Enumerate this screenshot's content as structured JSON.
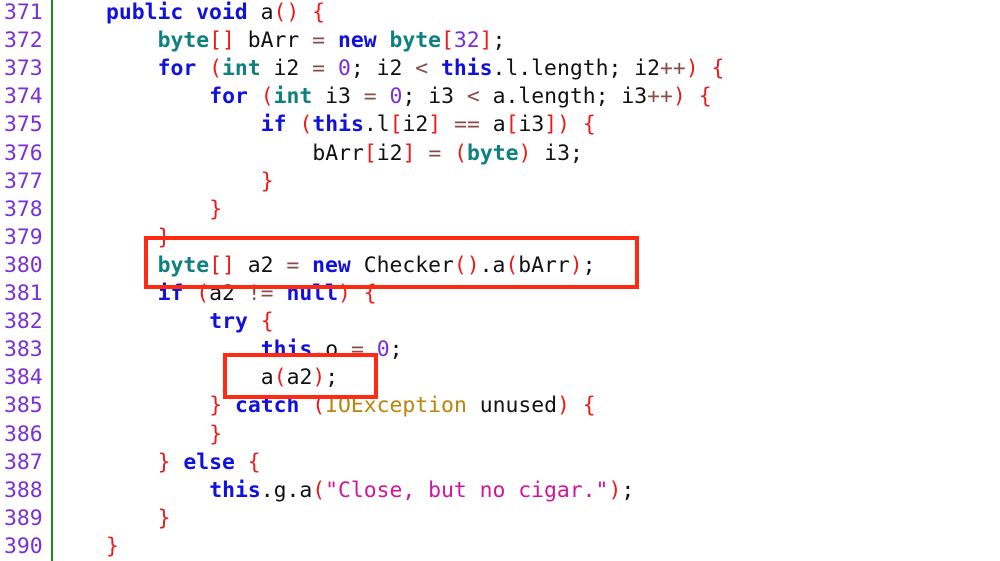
{
  "editor": {
    "first_line": 371,
    "lines": [
      {
        "num": "371",
        "indent": 0,
        "tokens": [
          [
            "kw",
            "public"
          ],
          [
            "",
            " "
          ],
          [
            "kw",
            "void"
          ],
          [
            "",
            " a"
          ],
          [
            "br",
            "()"
          ],
          [
            "",
            " "
          ],
          [
            "br",
            "{"
          ]
        ]
      },
      {
        "num": "372",
        "indent": 1,
        "tokens": [
          [
            "ty",
            "byte"
          ],
          [
            "br",
            "[]"
          ],
          [
            "",
            " bArr "
          ],
          [
            "op",
            "="
          ],
          [
            "",
            " "
          ],
          [
            "kw",
            "new"
          ],
          [
            "",
            " "
          ],
          [
            "ty",
            "byte"
          ],
          [
            "br",
            "["
          ],
          [
            "num",
            "32"
          ],
          [
            "br",
            "]"
          ],
          [
            "",
            ";"
          ]
        ]
      },
      {
        "num": "373",
        "indent": 1,
        "tokens": [
          [
            "kw",
            "for"
          ],
          [
            "",
            " "
          ],
          [
            "br",
            "("
          ],
          [
            "ty",
            "int"
          ],
          [
            "",
            " i2 "
          ],
          [
            "op",
            "="
          ],
          [
            "",
            " "
          ],
          [
            "num",
            "0"
          ],
          [
            "",
            "; i2 "
          ],
          [
            "op",
            "<"
          ],
          [
            "",
            " "
          ],
          [
            "kw",
            "this"
          ],
          [
            "",
            ".l.length; i2"
          ],
          [
            "op",
            "++"
          ],
          [
            "br",
            ")"
          ],
          [
            "",
            " "
          ],
          [
            "br",
            "{"
          ]
        ]
      },
      {
        "num": "374",
        "indent": 2,
        "tokens": [
          [
            "kw",
            "for"
          ],
          [
            "",
            " "
          ],
          [
            "br",
            "("
          ],
          [
            "ty",
            "int"
          ],
          [
            "",
            " i3 "
          ],
          [
            "op",
            "="
          ],
          [
            "",
            " "
          ],
          [
            "num",
            "0"
          ],
          [
            "",
            "; i3 "
          ],
          [
            "op",
            "<"
          ],
          [
            "",
            " a.length; i3"
          ],
          [
            "op",
            "++"
          ],
          [
            "br",
            ")"
          ],
          [
            "",
            " "
          ],
          [
            "br",
            "{"
          ]
        ]
      },
      {
        "num": "375",
        "indent": 3,
        "tokens": [
          [
            "kw",
            "if"
          ],
          [
            "",
            " "
          ],
          [
            "br",
            "("
          ],
          [
            "kw",
            "this"
          ],
          [
            "",
            ".l"
          ],
          [
            "br",
            "["
          ],
          [
            "",
            "i2"
          ],
          [
            "br",
            "]"
          ],
          [
            "",
            " "
          ],
          [
            "op",
            "=="
          ],
          [
            "",
            " a"
          ],
          [
            "br",
            "["
          ],
          [
            "",
            "i3"
          ],
          [
            "br",
            "])"
          ],
          [
            "",
            " "
          ],
          [
            "br",
            "{"
          ]
        ]
      },
      {
        "num": "376",
        "indent": 4,
        "tokens": [
          [
            "",
            "bArr"
          ],
          [
            "br",
            "["
          ],
          [
            "",
            "i2"
          ],
          [
            "br",
            "]"
          ],
          [
            "",
            " "
          ],
          [
            "op",
            "="
          ],
          [
            "",
            " "
          ],
          [
            "br",
            "("
          ],
          [
            "ty",
            "byte"
          ],
          [
            "br",
            ")"
          ],
          [
            "",
            " i3;"
          ]
        ]
      },
      {
        "num": "377",
        "indent": 3,
        "tokens": [
          [
            "br",
            "}"
          ]
        ]
      },
      {
        "num": "378",
        "indent": 2,
        "tokens": [
          [
            "br",
            "}"
          ]
        ]
      },
      {
        "num": "379",
        "indent": 1,
        "tokens": [
          [
            "br",
            "}"
          ]
        ]
      },
      {
        "num": "380",
        "indent": 1,
        "tokens": [
          [
            "ty",
            "byte"
          ],
          [
            "br",
            "[]"
          ],
          [
            "",
            " a2 "
          ],
          [
            "op",
            "="
          ],
          [
            "",
            " "
          ],
          [
            "kw",
            "new"
          ],
          [
            "",
            " Checker"
          ],
          [
            "br",
            "()"
          ],
          [
            "",
            ".a"
          ],
          [
            "br",
            "("
          ],
          [
            "",
            "bArr"
          ],
          [
            "br",
            ")"
          ],
          [
            "",
            ";"
          ]
        ]
      },
      {
        "num": "381",
        "indent": 1,
        "tokens": [
          [
            "kw",
            "if"
          ],
          [
            "",
            " "
          ],
          [
            "br",
            "("
          ],
          [
            "",
            "a2 "
          ],
          [
            "op",
            "!="
          ],
          [
            "",
            " "
          ],
          [
            "kw",
            "null"
          ],
          [
            "br",
            ")"
          ],
          [
            "",
            " "
          ],
          [
            "br",
            "{"
          ]
        ]
      },
      {
        "num": "382",
        "indent": 2,
        "tokens": [
          [
            "kw",
            "try"
          ],
          [
            "",
            " "
          ],
          [
            "br",
            "{"
          ]
        ]
      },
      {
        "num": "383",
        "indent": 3,
        "tokens": [
          [
            "kw",
            "this"
          ],
          [
            "",
            ".o "
          ],
          [
            "op",
            "="
          ],
          [
            "",
            " "
          ],
          [
            "num",
            "0"
          ],
          [
            "",
            ";"
          ]
        ]
      },
      {
        "num": "384",
        "indent": 3,
        "tokens": [
          [
            "",
            "a"
          ],
          [
            "br",
            "("
          ],
          [
            "",
            "a2"
          ],
          [
            "br",
            ")"
          ],
          [
            "",
            ";"
          ]
        ]
      },
      {
        "num": "385",
        "indent": 2,
        "tokens": [
          [
            "br",
            "}"
          ],
          [
            "",
            " "
          ],
          [
            "kw",
            "catch"
          ],
          [
            "",
            " "
          ],
          [
            "br",
            "("
          ],
          [
            "cls",
            "IOException"
          ],
          [
            "",
            " unused"
          ],
          [
            "br",
            ")"
          ],
          [
            "",
            " "
          ],
          [
            "br",
            "{"
          ]
        ]
      },
      {
        "num": "386",
        "indent": 2,
        "tokens": [
          [
            "br",
            "}"
          ]
        ]
      },
      {
        "num": "387",
        "indent": 1,
        "tokens": [
          [
            "br",
            "}"
          ],
          [
            "",
            " "
          ],
          [
            "kw",
            "else"
          ],
          [
            "",
            " "
          ],
          [
            "br",
            "{"
          ]
        ]
      },
      {
        "num": "388",
        "indent": 2,
        "tokens": [
          [
            "kw",
            "this"
          ],
          [
            "",
            ".g.a"
          ],
          [
            "br",
            "("
          ],
          [
            "str",
            "\"Close, but no cigar.\""
          ],
          [
            "br",
            ")"
          ],
          [
            "",
            ";"
          ]
        ]
      },
      {
        "num": "389",
        "indent": 1,
        "tokens": [
          [
            "br",
            "}"
          ]
        ]
      },
      {
        "num": "390",
        "indent": 0,
        "tokens": [
          [
            "br",
            "}"
          ]
        ]
      }
    ]
  },
  "highlights": [
    {
      "label": "checker-call-highlight",
      "line": "380"
    },
    {
      "label": "a-call-highlight",
      "line": "384"
    }
  ],
  "colors": {
    "keyword": "#1010e0",
    "type": "#0e8080",
    "bracket": "#ee1a1a",
    "operator": "#8b4a4a",
    "number": "#7a2fd6",
    "string": "#d4159a",
    "class": "#b8860b",
    "line_number": "#7a2fd6",
    "gutter_line": "#1e8a1e",
    "highlight_box": "#ff2a12"
  }
}
